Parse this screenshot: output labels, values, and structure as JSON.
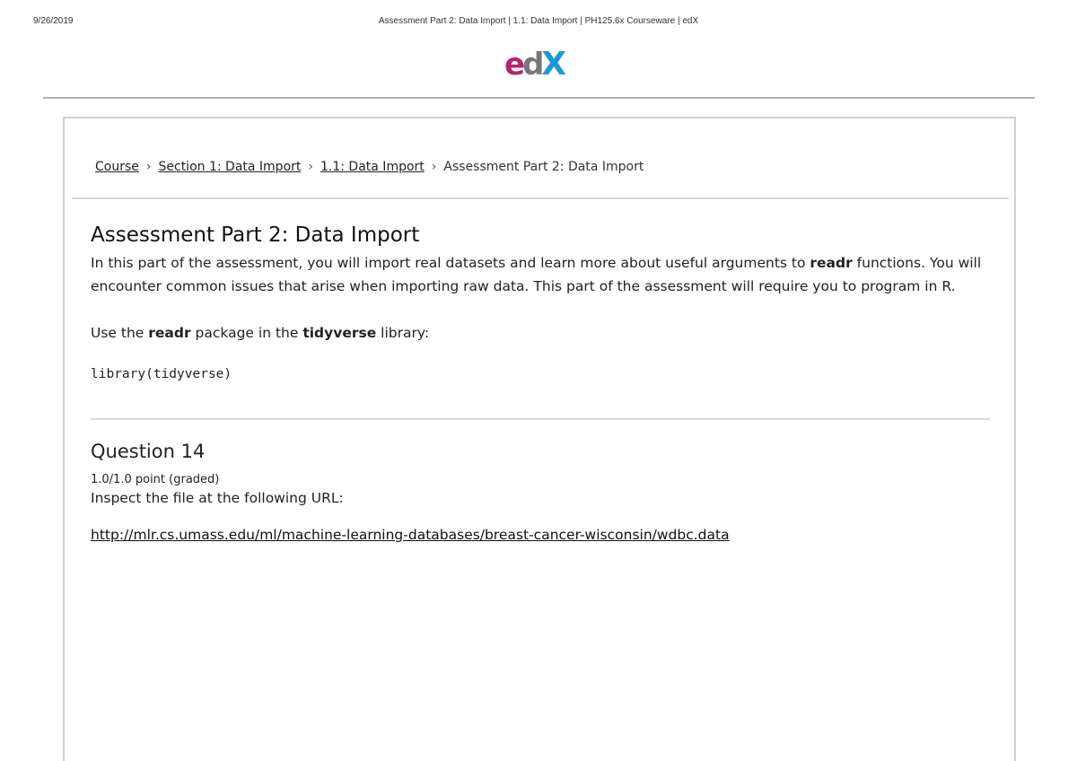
{
  "print_header": {
    "date": "9/26/2019",
    "title": "Assessment Part 2: Data Import | 1.1: Data Import | PH125.6x Courseware | edX"
  },
  "logo": {
    "e": "e",
    "d": "d",
    "x": "X",
    "colors": {
      "e": "#b8256b",
      "d": "#777777",
      "x": "#1a9ad6"
    }
  },
  "breadcrumb": {
    "items": [
      "Course",
      "Section 1: Data Import",
      "1.1: Data Import"
    ],
    "current": "Assessment Part 2: Data Import",
    "separator": "›"
  },
  "problem": {
    "title": "Assessment Part 2: Data Import",
    "intro_part1": "In this part of the assessment, you will import real datasets and learn more about useful arguments to ",
    "intro_bold": "readr",
    "intro_part2": " functions. You will encounter common issues that arise when importing raw data. This part of the assessment will require you to program in R.",
    "usage_part1": "Use the ",
    "usage_bold1": "readr",
    "usage_part2": " package in the ",
    "usage_bold2": "tidyverse",
    "usage_part3": " library:",
    "code": "library(tidyverse)"
  },
  "question": {
    "title": "Question 14",
    "points": "1.0/1.0 point (graded)",
    "prompt": "Inspect the file at the following URL:",
    "url": "http://mlr.cs.umass.edu/ml/machine-learning-databases/breast-cancer-wisconsin/wdbc.data"
  }
}
